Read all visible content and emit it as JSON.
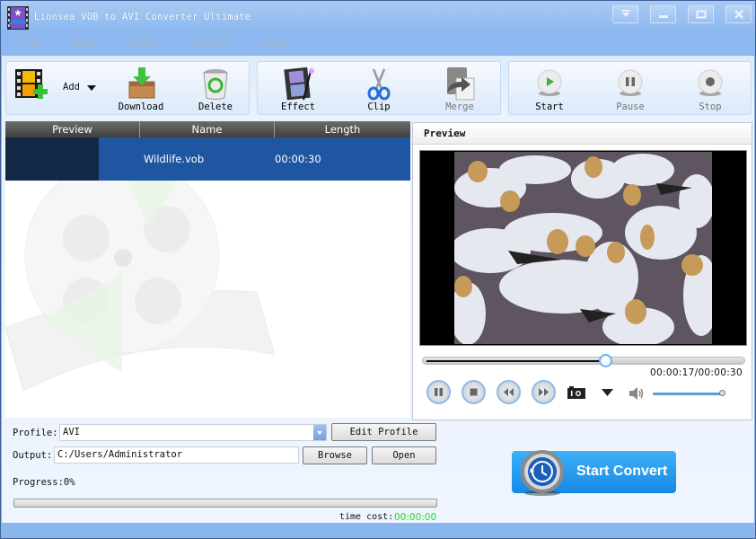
{
  "window": {
    "title": "Lionsea VOB to AVI Converter Ultimate",
    "controls": [
      {
        "name": "skin-menu",
        "glyph": "▾"
      },
      {
        "name": "minimize",
        "glyph": "▁"
      },
      {
        "name": "maximize",
        "glyph": "▢"
      },
      {
        "name": "close",
        "glyph": "x"
      }
    ]
  },
  "menu": [
    "File",
    "Edit",
    "Tools",
    "Actions",
    "Help"
  ],
  "toolbar": {
    "add": {
      "label": "Add",
      "icon": "film-add-icon"
    },
    "download": {
      "label": "Download",
      "icon": "download-box-icon"
    },
    "delete": {
      "label": "Delete",
      "icon": "recycle-bin-icon"
    },
    "effect": {
      "label": "Effect",
      "icon": "film-effect-icon"
    },
    "clip": {
      "label": "Clip",
      "icon": "scissors-icon"
    },
    "merge": {
      "label": "Merge",
      "icon": "merge-icon",
      "disabled": true
    },
    "start": {
      "label": "Start",
      "icon": "play-icon"
    },
    "pause": {
      "label": "Pause",
      "icon": "pause-icon",
      "disabled": true
    },
    "stop": {
      "label": "Stop",
      "icon": "stop-icon",
      "disabled": true
    }
  },
  "file_list": {
    "columns": [
      "Preview",
      "Name",
      "Length"
    ],
    "rows": [
      {
        "name": "Wildlife.vob",
        "length": "00:00:30",
        "selected": true
      }
    ]
  },
  "preview": {
    "title": "Preview",
    "current_time": "00:00:17",
    "total_time": "00:00:30",
    "time_readout": "00:00:17/00:00:30",
    "seek_fraction": 0.567,
    "volume_fraction": 1.0
  },
  "settings": {
    "profile_label": "Profile:",
    "profile_value": "AVI",
    "edit_profile_label": "Edit Profile",
    "output_label": "Output:",
    "output_value": "C:/Users/Administrator",
    "browse_label": "Browse",
    "open_label": "Open",
    "progress_label": "Progress:",
    "progress_value": "0%",
    "progress_fraction": 0,
    "time_cost_label": "time cost:",
    "time_cost_value": "00:00:00"
  },
  "start_convert": {
    "label": "Start Convert"
  },
  "colors": {
    "accent": "#1f56a2",
    "title_bar": "#8cb8ef",
    "time_cost": "#22dd22",
    "convert_button": "#1f94ee"
  }
}
